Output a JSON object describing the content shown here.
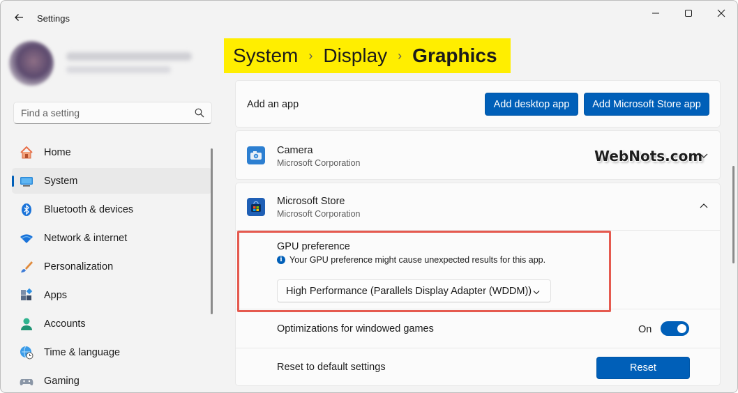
{
  "window": {
    "title": "Settings"
  },
  "search": {
    "placeholder": "Find a setting"
  },
  "sidebar": {
    "items": [
      {
        "label": "Home",
        "icon": "home-icon",
        "active": false
      },
      {
        "label": "System",
        "icon": "system-icon",
        "active": true
      },
      {
        "label": "Bluetooth & devices",
        "icon": "bluetooth-icon",
        "active": false
      },
      {
        "label": "Network & internet",
        "icon": "wifi-icon",
        "active": false
      },
      {
        "label": "Personalization",
        "icon": "brush-icon",
        "active": false
      },
      {
        "label": "Apps",
        "icon": "apps-icon",
        "active": false
      },
      {
        "label": "Accounts",
        "icon": "accounts-icon",
        "active": false
      },
      {
        "label": "Time & language",
        "icon": "time-language-icon",
        "active": false
      },
      {
        "label": "Gaming",
        "icon": "gaming-icon",
        "active": false
      }
    ]
  },
  "breadcrumb": {
    "items": [
      "System",
      "Display",
      "Graphics"
    ]
  },
  "add_app": {
    "label": "Add an app",
    "desktop_button": "Add desktop app",
    "store_button": "Add Microsoft Store app"
  },
  "apps": [
    {
      "name": "Camera",
      "publisher": "Microsoft Corporation",
      "expanded": false
    },
    {
      "name": "Microsoft Store",
      "publisher": "Microsoft Corporation",
      "expanded": true
    }
  ],
  "watermark": "WebNots.com",
  "gpu": {
    "title": "GPU preference",
    "warning": "Your GPU preference might cause unexpected results for this app.",
    "selected": "High Performance (Parallels Display Adapter (WDDM))"
  },
  "optimizations": {
    "label": "Optimizations for windowed games",
    "state_label": "On",
    "enabled": true
  },
  "reset": {
    "label": "Reset to default settings",
    "button": "Reset"
  },
  "colors": {
    "accent": "#005fb8",
    "highlight_yellow": "#ffee00",
    "annotation_red": "#e55a4f"
  }
}
